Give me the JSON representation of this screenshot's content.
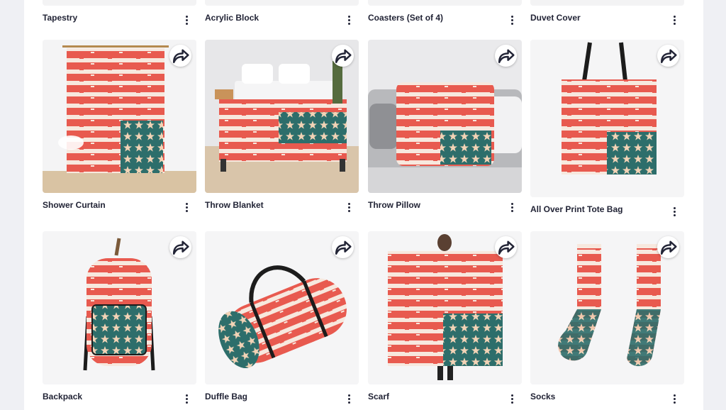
{
  "colors": {
    "red": "#e85a4f",
    "cream": "#f7e8de",
    "teal": "#2d6e6b",
    "star": "#f2d3b6",
    "dark": "#222436"
  },
  "top_row": [
    {
      "title": "Tapestry"
    },
    {
      "title": "Acrylic Block"
    },
    {
      "title": "Coasters (Set of 4)"
    },
    {
      "title": "Duvet Cover"
    }
  ],
  "row1": [
    {
      "title": "Shower Curtain"
    },
    {
      "title": "Throw Blanket"
    },
    {
      "title": "Throw Pillow"
    },
    {
      "title": "All Over Print Tote Bag"
    }
  ],
  "row2": [
    {
      "title": "Backpack"
    },
    {
      "title": "Duffle Bag"
    },
    {
      "title": "Scarf"
    },
    {
      "title": "Socks"
    }
  ],
  "icons": {
    "share": "share-arrow-icon",
    "more": "vertical-ellipsis-icon"
  }
}
